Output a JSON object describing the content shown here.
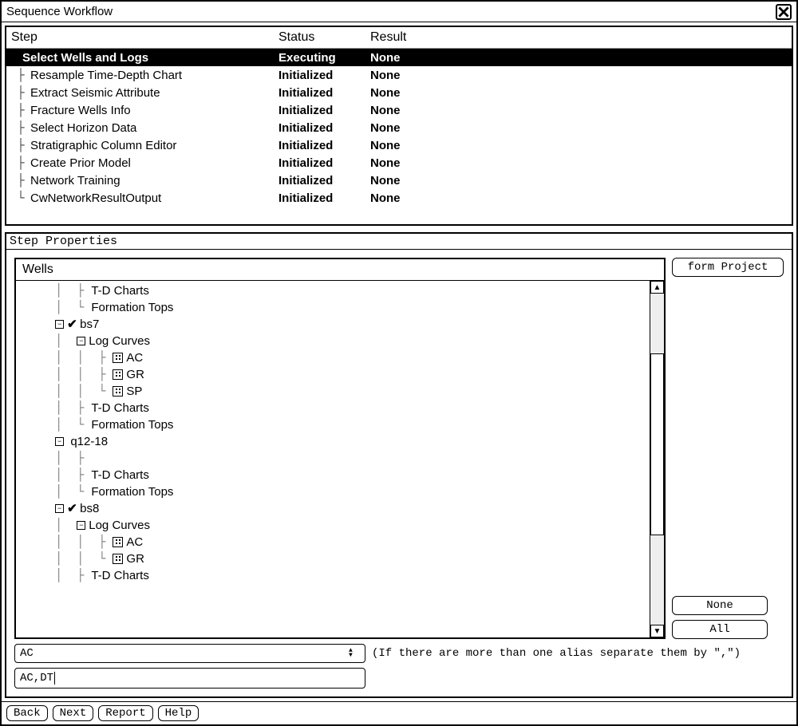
{
  "window": {
    "title": "Sequence Workflow"
  },
  "steps": {
    "headers": {
      "step": "Step",
      "status": "Status",
      "result": "Result"
    },
    "rows": [
      {
        "name": "Select Wells and Logs",
        "status": "Executing",
        "result": "None",
        "selected": true
      },
      {
        "name": "Resample Time-Depth Chart",
        "status": "Initialized",
        "result": "None",
        "selected": false
      },
      {
        "name": "Extract Seismic Attribute",
        "status": "Initialized",
        "result": "None",
        "selected": false
      },
      {
        "name": "Fracture Wells Info",
        "status": "Initialized",
        "result": "None",
        "selected": false
      },
      {
        "name": "Select Horizon Data",
        "status": "Initialized",
        "result": "None",
        "selected": false
      },
      {
        "name": "Stratigraphic Column Editor",
        "status": "Initialized",
        "result": "None",
        "selected": false
      },
      {
        "name": "Create Prior Model",
        "status": "Initialized",
        "result": "None",
        "selected": false
      },
      {
        "name": "Network Training",
        "status": "Initialized",
        "result": "None",
        "selected": false
      },
      {
        "name": "CwNetworkResultOutput",
        "status": "Initialized",
        "result": "None",
        "selected": false
      }
    ]
  },
  "props": {
    "title": "Step Properties",
    "tree_header": "Wells",
    "buttons": {
      "form_project": "form Project",
      "none": "None",
      "all": "All"
    },
    "combo_value": "AC",
    "hint": "(If there are more than one alias separate them by \",\")",
    "input_value": "AC,DT",
    "tree": [
      {
        "indent": "     │  ├─",
        "expander": "",
        "check": "",
        "icon": "",
        "label": "T-D Charts"
      },
      {
        "indent": "     │  └─",
        "expander": "",
        "check": "",
        "icon": "",
        "label": "Formation Tops"
      },
      {
        "indent": "     ",
        "expander": "minus",
        "check": "✓",
        "icon": "",
        "label": "bs7"
      },
      {
        "indent": "     │  ",
        "expander": "minus",
        "check": "",
        "icon": "",
        "label": "Log Curves"
      },
      {
        "indent": "     │  │  ├─",
        "expander": "",
        "check": "",
        "icon": "log",
        "label": "AC"
      },
      {
        "indent": "     │  │  ├─",
        "expander": "",
        "check": "",
        "icon": "log",
        "label": "GR"
      },
      {
        "indent": "     │  │  └─",
        "expander": "",
        "check": "",
        "icon": "log",
        "label": "SP"
      },
      {
        "indent": "     │  ├─",
        "expander": "",
        "check": "",
        "icon": "",
        "label": "T-D Charts"
      },
      {
        "indent": "     │  └─",
        "expander": "",
        "check": "",
        "icon": "",
        "label": "Formation Tops"
      },
      {
        "indent": "     ",
        "expander": "minus",
        "check": "",
        "icon": "",
        "label": " q12-18"
      },
      {
        "indent": "     │  ├─",
        "expander": "",
        "check": "",
        "icon": "",
        "label": ""
      },
      {
        "indent": "     │  ├─",
        "expander": "",
        "check": "",
        "icon": "",
        "label": "T-D Charts"
      },
      {
        "indent": "     │  └─",
        "expander": "",
        "check": "",
        "icon": "",
        "label": "Formation Tops"
      },
      {
        "indent": "     ",
        "expander": "minus",
        "check": "✓",
        "icon": "",
        "label": "bs8"
      },
      {
        "indent": "     │  ",
        "expander": "minus",
        "check": "",
        "icon": "",
        "label": "Log Curves"
      },
      {
        "indent": "     │  │  ├─",
        "expander": "",
        "check": "",
        "icon": "log",
        "label": "AC"
      },
      {
        "indent": "     │  │  └─",
        "expander": "",
        "check": "",
        "icon": "log",
        "label": "GR"
      },
      {
        "indent": "     │  ├─",
        "expander": "",
        "check": "",
        "icon": "",
        "label": "T-D Charts"
      }
    ]
  },
  "footer": {
    "back": "Back",
    "next": "Next",
    "report": "Report",
    "help": "Help"
  }
}
